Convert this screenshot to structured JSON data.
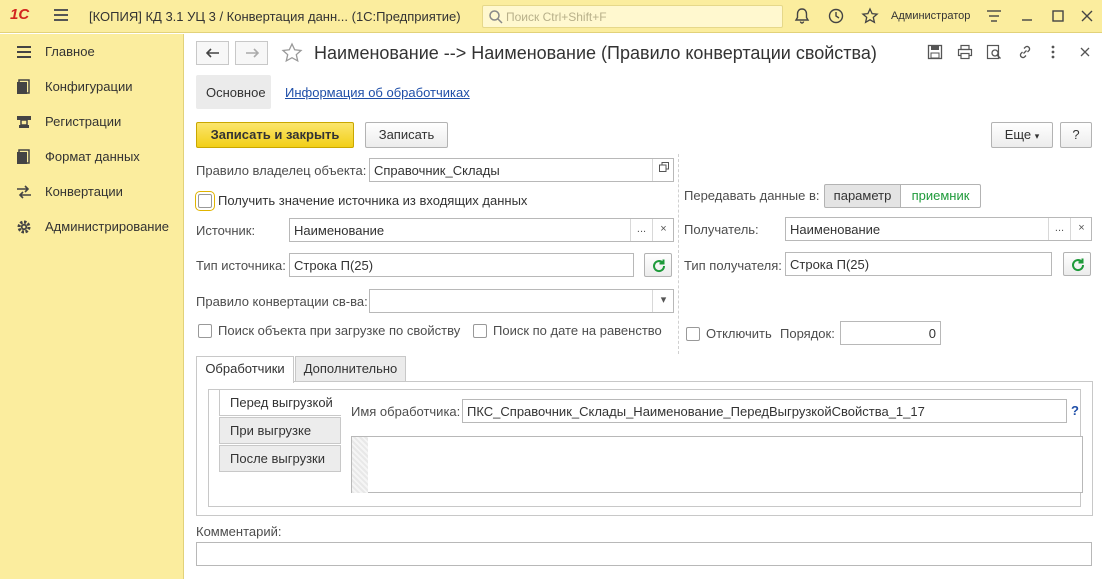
{
  "titlebar": {
    "logo": "1С",
    "title": "[КОПИЯ] КД 3.1 УЦ 3 / Конвертация данн...  (1С:Предприятие)",
    "search_placeholder": "Поиск Ctrl+Shift+F",
    "user": "Администратор"
  },
  "sidebar": {
    "items": [
      {
        "label": "Главное",
        "icon": "menu-lines-icon"
      },
      {
        "label": "Конфигурации",
        "icon": "document-icon"
      },
      {
        "label": "Регистрации",
        "icon": "registration-icon"
      },
      {
        "label": "Формат данных",
        "icon": "document-icon"
      },
      {
        "label": "Конвертации",
        "icon": "arrows-icon"
      },
      {
        "label": "Администрирование",
        "icon": "gear-icon"
      }
    ]
  },
  "form": {
    "title": "Наименование --> Наименование (Правило конвертации свойства)",
    "tab_main": "Основное",
    "tab_handlers_link": "Информация об обработчиках",
    "save_close": "Записать и закрыть",
    "save": "Записать",
    "more": "Еще",
    "help": "?",
    "owner_rule_label": "Правило владелец объекта:",
    "owner_rule_value": "Справочник_Склады",
    "get_from_incoming": "Получить значение источника из входящих данных",
    "transfer_label": "Передавать данные в:",
    "transfer_param": "параметр",
    "transfer_receiver": "приемник",
    "source_label": "Источник:",
    "source_value": "Наименование",
    "receiver_label": "Получатель:",
    "receiver_value": "Наименование",
    "source_type_label": "Тип источника:",
    "source_type_value": "Строка П(25)",
    "receiver_type_label": "Тип получателя:",
    "receiver_type_value": "Строка П(25)",
    "conv_rule_label": "Правило конвертации св-ва:",
    "conv_rule_value": "",
    "search_by_prop": "Поиск объекта при загрузке по свойству",
    "search_by_date": "Поиск по дате на равенство",
    "disable": "Отключить",
    "order_label": "Порядок:",
    "order_value": "0",
    "ellipsis": "...",
    "clear": "×",
    "dropdown": "▾"
  },
  "bottom": {
    "tab_handlers": "Обработчики",
    "tab_extra": "Дополнительно",
    "vtabs": [
      "Перед выгрузкой",
      "При выгрузке",
      "После выгрузки"
    ],
    "handler_name_label": "Имя обработчика:",
    "handler_name_value": "ПКС_Справочник_Склады_Наименование_ПередВыгрузкойСвойства_1_17",
    "help": "?",
    "comment_label": "Комментарий:",
    "comment_value": ""
  },
  "colors": {
    "accent": "#fbed9e",
    "primary_button": "#f2cf17",
    "link": "#1f4fa8",
    "green": "#1e9a3a"
  }
}
